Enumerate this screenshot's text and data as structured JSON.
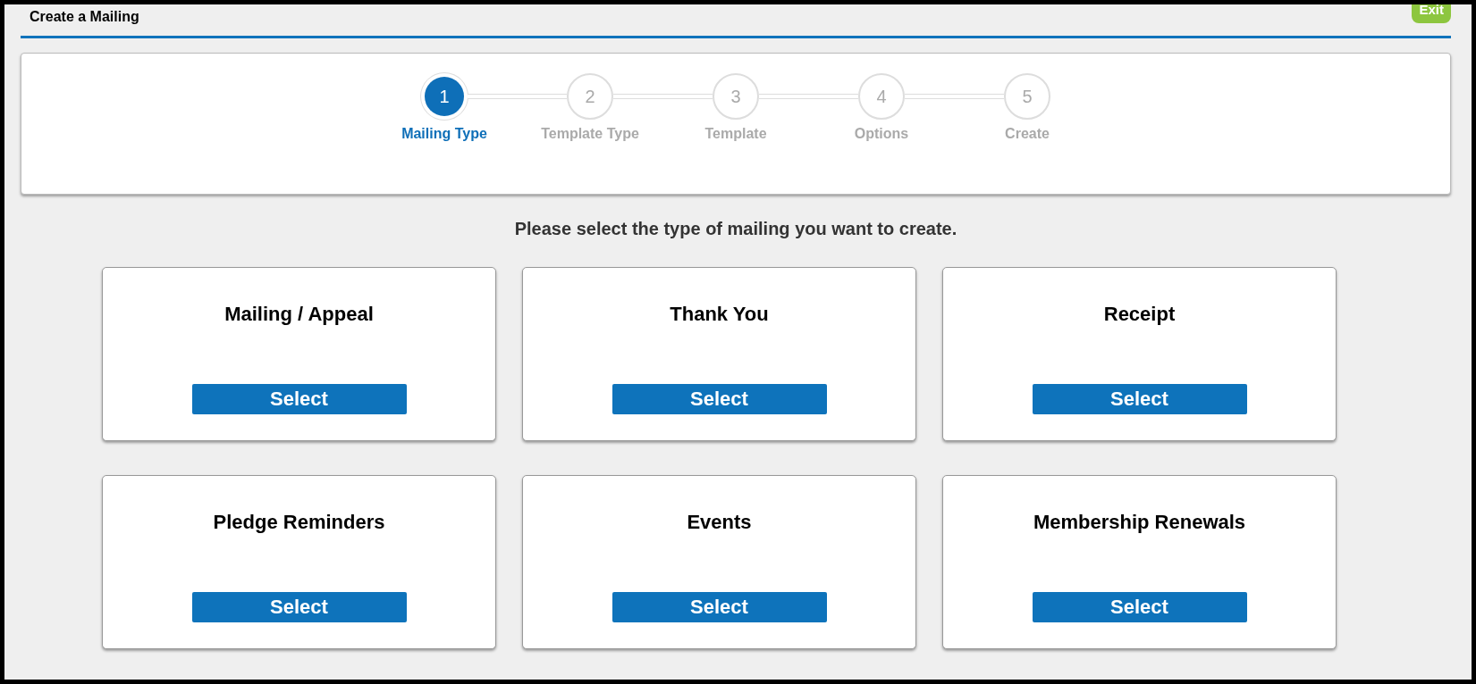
{
  "window": {
    "title": "Create a Mailing"
  },
  "exit_button": {
    "label": "Exit"
  },
  "steps": [
    {
      "number": "1",
      "label": "Mailing Type",
      "selected": true
    },
    {
      "number": "2",
      "label": "Template Type",
      "selected": false
    },
    {
      "number": "3",
      "label": "Template",
      "selected": false
    },
    {
      "number": "4",
      "label": "Options",
      "selected": false
    },
    {
      "number": "5",
      "label": "Create",
      "selected": false
    }
  ],
  "prompt": "Please select the type of mailing you want to create.",
  "mailing_types": [
    {
      "title": "Mailing / Appeal",
      "button": "Select"
    },
    {
      "title": "Thank You",
      "button": "Select"
    },
    {
      "title": "Receipt",
      "button": "Select"
    },
    {
      "title": "Pledge Reminders",
      "button": "Select"
    },
    {
      "title": "Events",
      "button": "Select"
    },
    {
      "title": "Membership Renewals",
      "button": "Select"
    }
  ]
}
